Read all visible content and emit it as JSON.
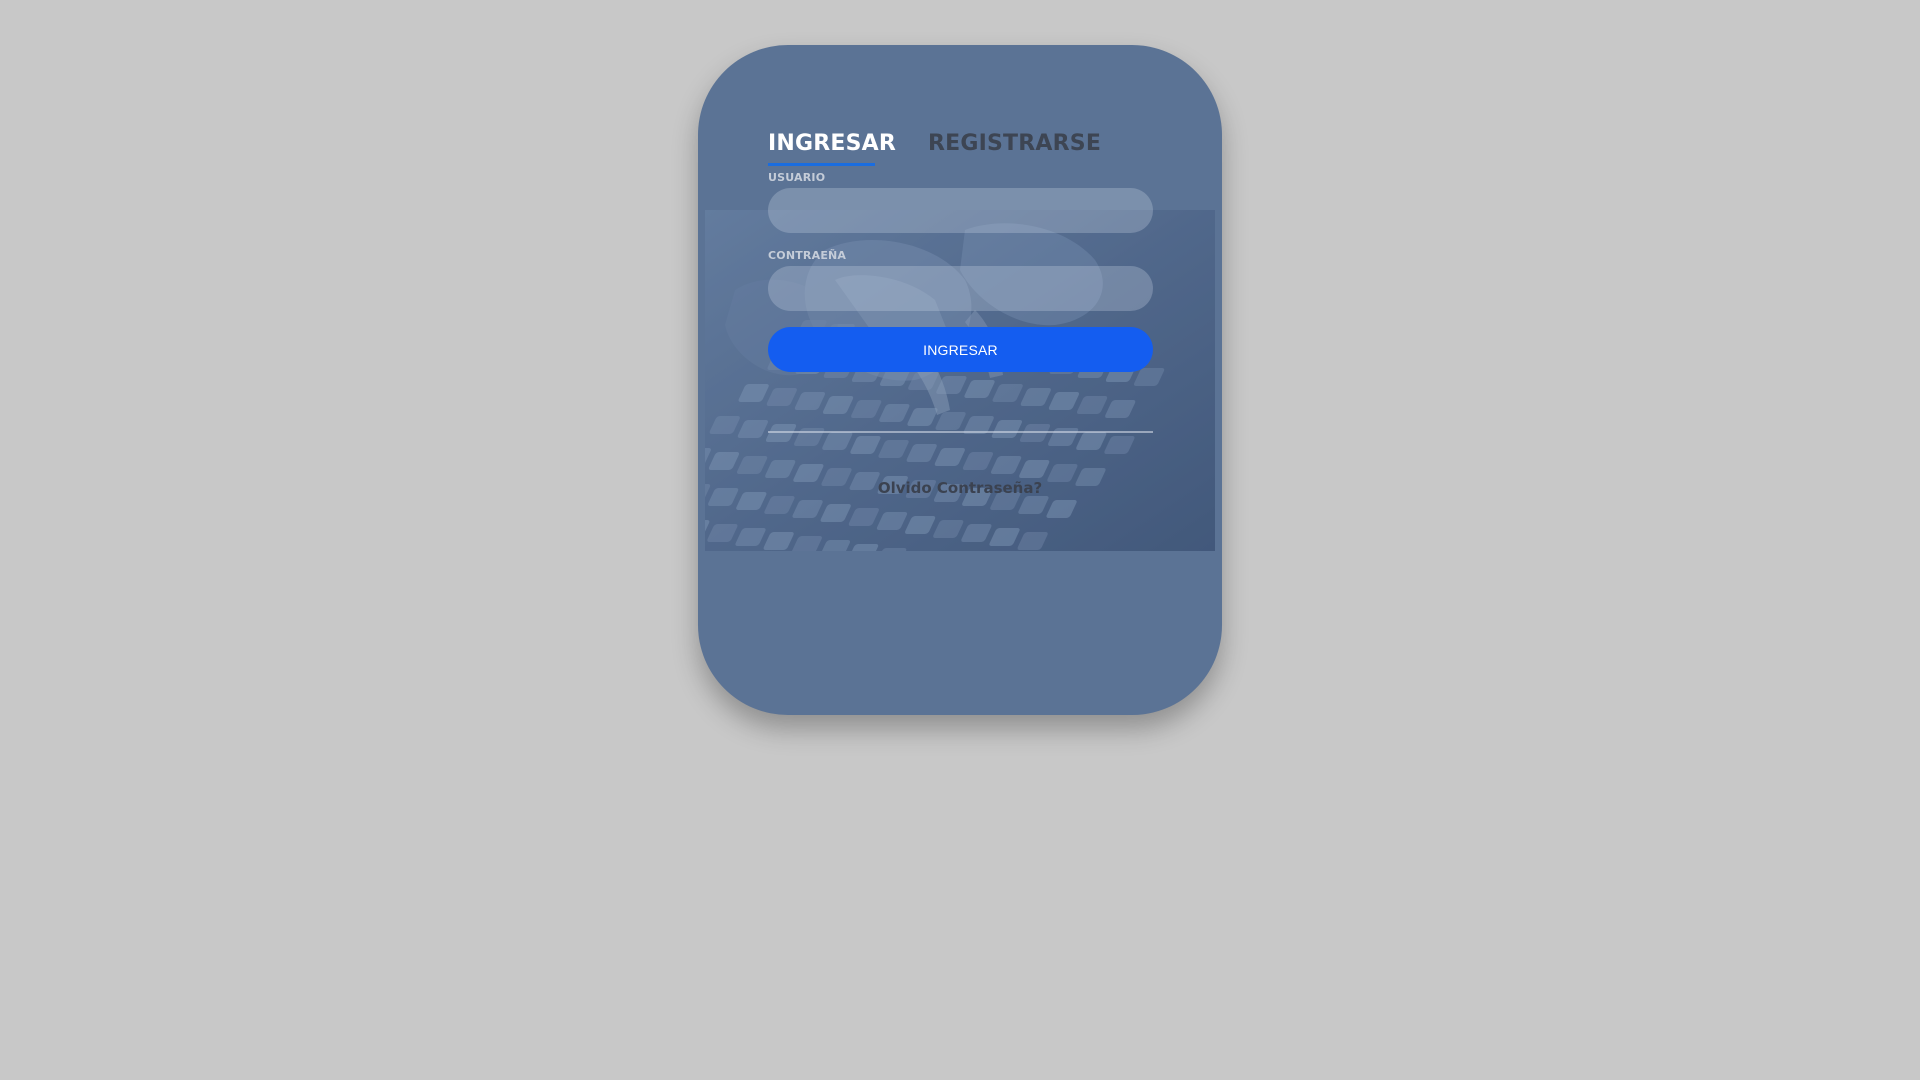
{
  "tabs": {
    "login_label": "INGRESAR",
    "register_label": "REGISTRARSE"
  },
  "form": {
    "username_label": "USUARIO",
    "username_value": "",
    "password_label": "CONTRAEÑA",
    "password_value": "",
    "submit_label": "INGRESAR"
  },
  "links": {
    "forgot_password": "Olvido Contraseña?"
  },
  "colors": {
    "page_background": "#c8c8c8",
    "card_background": "#5b7395",
    "accent": "#145df0",
    "active_tab_underline": "#1a6de0"
  },
  "background_image": "hands-typing-on-keyboard"
}
